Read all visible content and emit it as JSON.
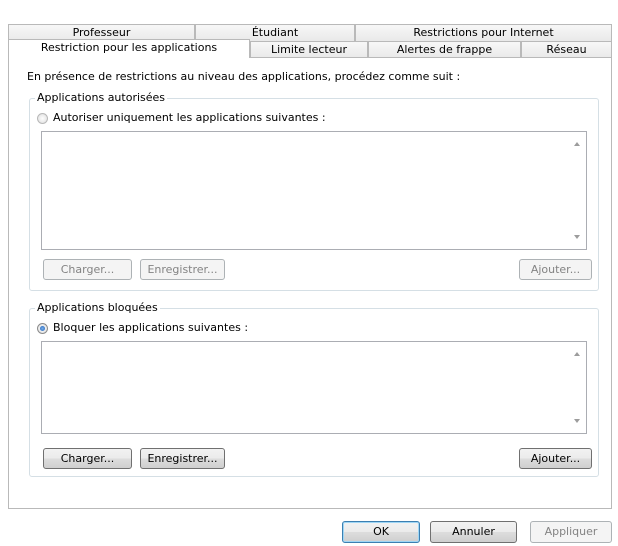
{
  "tabs": {
    "row_back": [
      {
        "label": "Professeur"
      },
      {
        "label": "Étudiant"
      },
      {
        "label": "Restrictions pour Internet"
      }
    ],
    "row_front": [
      {
        "label": "Restriction pour les applications"
      },
      {
        "label": "Limite lecteur"
      },
      {
        "label": "Alertes de frappe"
      },
      {
        "label": "Réseau"
      }
    ]
  },
  "panel": {
    "intro_text": "En présence de restrictions au niveau des applications, procédez comme suit :",
    "allowed": {
      "group_label": "Applications autorisées",
      "radio_label": "Autoriser uniquement les applications suivantes :",
      "selected": false,
      "load_button": "Charger...",
      "save_button": "Enregistrer...",
      "add_button": "Ajouter..."
    },
    "blocked": {
      "group_label": "Applications bloquées",
      "radio_label": "Bloquer les applications suivantes :",
      "selected": true,
      "load_button": "Charger...",
      "save_button": "Enregistrer...",
      "add_button": "Ajouter..."
    }
  },
  "footer": {
    "ok_button": "OK",
    "cancel_button": "Annuler",
    "apply_button": "Appliquer"
  }
}
